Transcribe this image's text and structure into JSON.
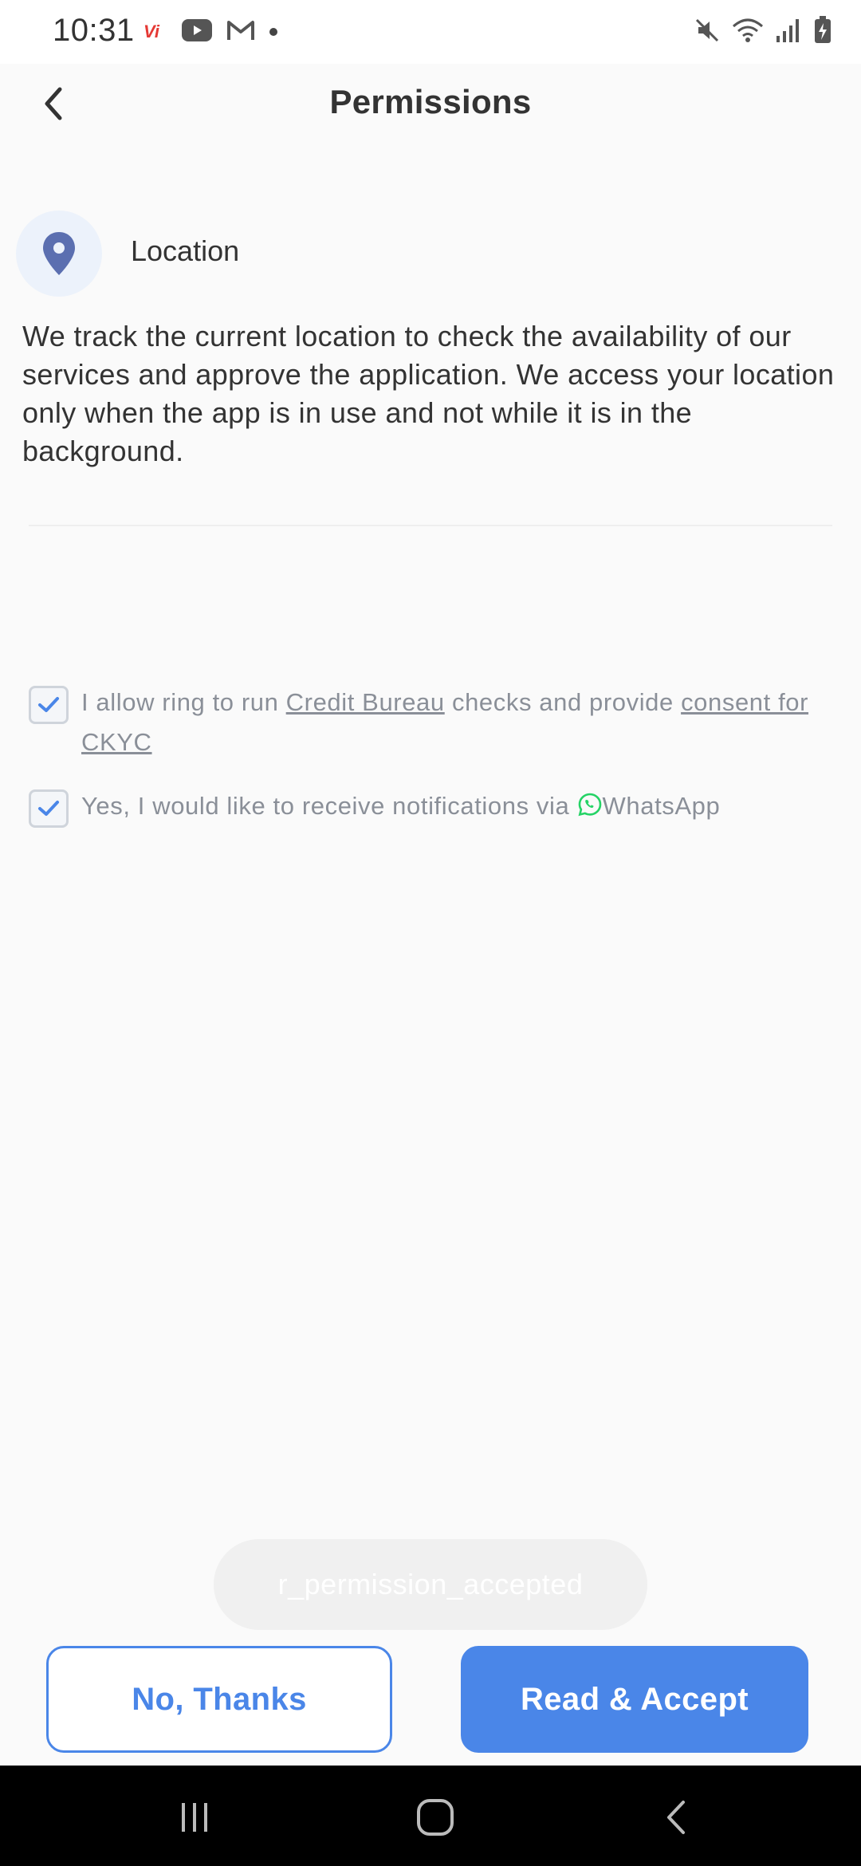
{
  "status_bar": {
    "time": "10:31",
    "left_icons": [
      "vi-carrier-icon",
      "youtube-icon",
      "gmail-icon",
      "dot-icon"
    ],
    "right_icons": [
      "mute-icon",
      "wifi-icon",
      "signal-icon",
      "battery-icon"
    ],
    "carrier_label": "Vi"
  },
  "header": {
    "title": "Permissions",
    "back_icon": "chevron-left-icon"
  },
  "permission": {
    "icon": "location-pin-icon",
    "title": "Location",
    "description": "We track the current location to check the availability of our services and approve the application. We access your location only when the app is in use and not while it is in the background."
  },
  "consents": [
    {
      "checked": true,
      "text_before": " I allow ring to run ",
      "link1": "Credit Bureau",
      "text_middle": " checks and provide ",
      "link2": "consent for CKYC"
    },
    {
      "checked": true,
      "text_before": "Yes, I would like to receive notifications via ",
      "icon": "whatsapp-icon",
      "text_after": "WhatsApp"
    }
  ],
  "toast": {
    "text": "r_permission_accepted"
  },
  "buttons": {
    "decline": "No, Thanks",
    "accept": "Read & Accept"
  },
  "colors": {
    "accent": "#4a86e8",
    "location_icon": "#5b6fb0",
    "whatsapp": "#25d366"
  },
  "nav_bar": {
    "icons": [
      "recent-apps-icon",
      "home-icon",
      "back-icon"
    ]
  }
}
